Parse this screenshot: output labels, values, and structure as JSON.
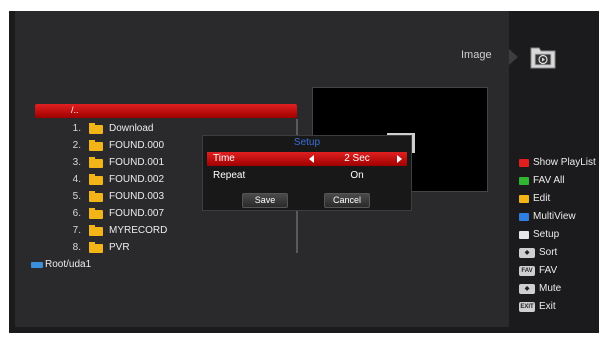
{
  "header": {
    "section_title": "Image",
    "section_icon": "folder-image-icon"
  },
  "path_bar": {
    "text": "/.."
  },
  "files": [
    {
      "num": "1.",
      "name": "Download"
    },
    {
      "num": "2.",
      "name": "FOUND.000"
    },
    {
      "num": "3.",
      "name": "FOUND.001"
    },
    {
      "num": "4.",
      "name": "FOUND.002"
    },
    {
      "num": "5.",
      "name": "FOUND.003"
    },
    {
      "num": "6.",
      "name": "FOUND.007"
    },
    {
      "num": "7.",
      "name": "MYRECORD"
    },
    {
      "num": "8.",
      "name": "PVR"
    }
  ],
  "footer": {
    "root_path": "Root/uda1"
  },
  "dialog": {
    "title": "Setup",
    "time_label": "Time",
    "time_value": "2 Sec",
    "repeat_label": "Repeat",
    "repeat_value": "On",
    "save_label": "Save",
    "cancel_label": "Cancel"
  },
  "legend": {
    "show_playlist": {
      "label": "Show PlayList",
      "color": "#e01e1e"
    },
    "fav_all": {
      "label": "FAV All",
      "color": "#2fb52f"
    },
    "edit": {
      "label": "Edit",
      "color": "#f2b417"
    },
    "multiview": {
      "label": "MultiView",
      "color": "#2f7fe0"
    },
    "setup": {
      "label": "Setup",
      "color": "#e6e6e6"
    },
    "sort": {
      "label": "Sort",
      "key": "◆"
    },
    "fav": {
      "label": "FAV",
      "key": "FAV"
    },
    "mute": {
      "label": "Mute",
      "key": "◆"
    },
    "exit": {
      "label": "Exit",
      "key": "EXIT"
    }
  }
}
